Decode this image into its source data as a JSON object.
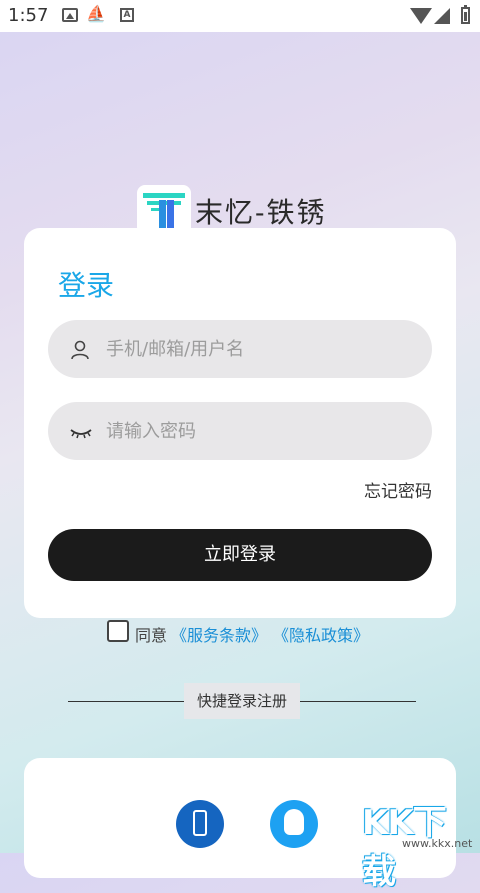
{
  "status_bar": {
    "time": "1:57",
    "icons": [
      "gallery-icon",
      "ship-icon",
      "a-badge-icon",
      "wifi-icon",
      "signal-icon",
      "battery-icon"
    ],
    "a_badge": "A"
  },
  "logo": {
    "text": "末忆-铁锈",
    "colors": {
      "cyan": "#2bd5c3",
      "blue": "#3a73e6"
    }
  },
  "login": {
    "title": "登录",
    "username_placeholder": "手机/邮箱/用户名",
    "username_value": "",
    "password_placeholder": "请输入密码",
    "password_value": "",
    "forgot_label": "忘记密码",
    "submit_label": "立即登录"
  },
  "agreement": {
    "prefix": "同意",
    "terms_link": "《服务条款》",
    "privacy_link": "《隐私政策》",
    "checked": false
  },
  "quick": {
    "divider_label": "快捷登录注册",
    "options": [
      "phone-icon",
      "qq-icon"
    ]
  },
  "watermark": {
    "text": "KK下载",
    "url": "www.kkx.net"
  },
  "colors": {
    "accent": "#1aa7e8",
    "button": "#1b1b1b",
    "link": "#1b8fd6"
  }
}
